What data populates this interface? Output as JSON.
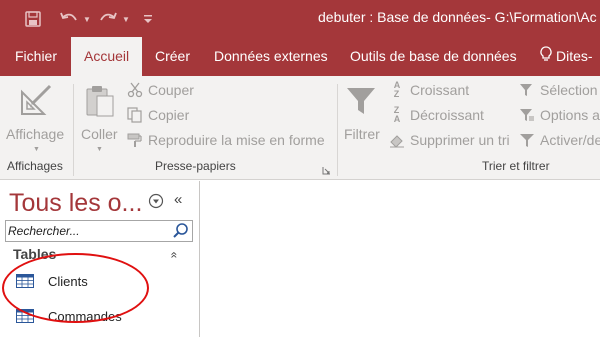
{
  "window": {
    "title": "debuter : Base de données- G:\\Formation\\Ac"
  },
  "tabs": [
    {
      "label": "Fichier"
    },
    {
      "label": "Accueil"
    },
    {
      "label": "Créer"
    },
    {
      "label": "Données externes"
    },
    {
      "label": "Outils de base de données"
    },
    {
      "label": "Dites-"
    }
  ],
  "active_tab": "Accueil",
  "ribbon": {
    "affichages": {
      "group_label": "Affichages",
      "affichage_label": "Affichage"
    },
    "presse_papiers": {
      "group_label": "Presse-papiers",
      "coller_label": "Coller",
      "couper_label": "Couper",
      "copier_label": "Copier",
      "reproduire_label": "Reproduire la mise en forme"
    },
    "trier_filtrer": {
      "group_label": "Trier et filtrer",
      "filtrer_label": "Filtrer",
      "croissant_label": "Croissant",
      "decroissant_label": "Décroissant",
      "supprimer_tri_label": "Supprimer un tri",
      "selection_label": "Sélection",
      "options_label": "Options a",
      "activer_label": "Activer/de"
    }
  },
  "nav_pane": {
    "title": "Tous les o...",
    "search_placeholder": "Rechercher...",
    "section_label": "Tables",
    "items": [
      {
        "label": "Clients"
      },
      {
        "label": "Commandes"
      }
    ]
  },
  "colors": {
    "brand": "#a4373a",
    "annotation": "#e01010"
  }
}
